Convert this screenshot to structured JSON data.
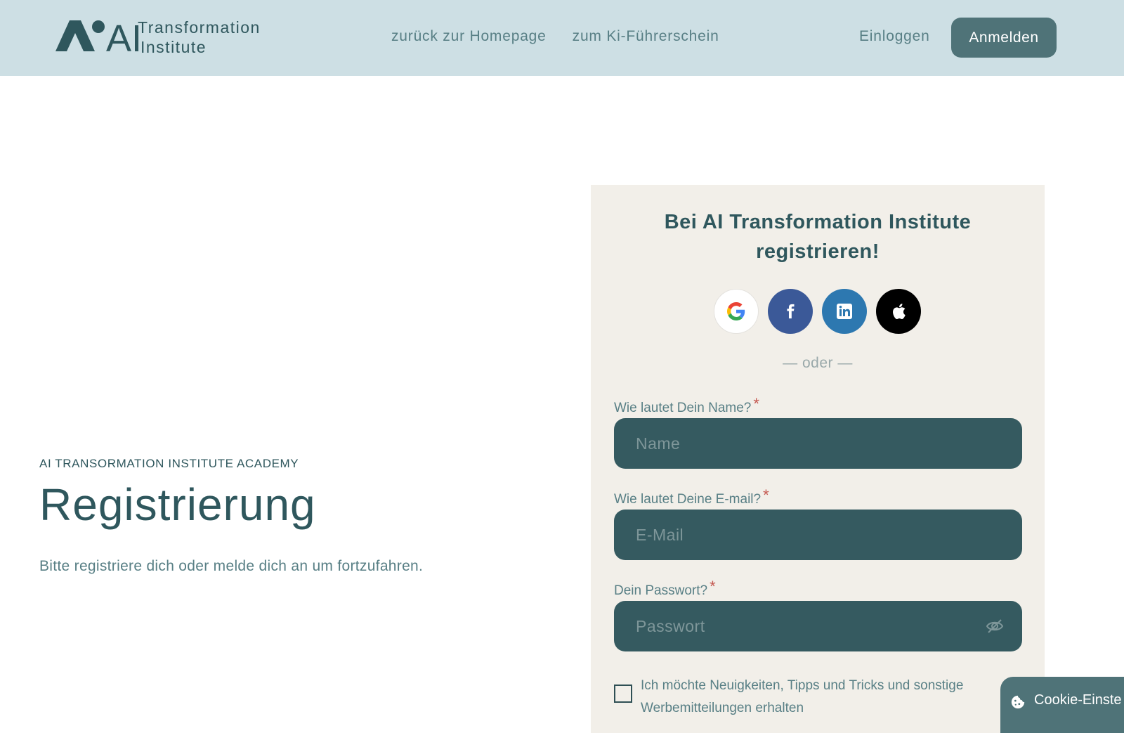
{
  "header": {
    "logo_mark_text": "AI",
    "logo_text_line1": "Transformation",
    "logo_text_line2": "Institute",
    "nav": [
      {
        "label": "zurück zur Homepage"
      },
      {
        "label": "zum Ki-Führerschein"
      }
    ],
    "login_label": "Einloggen",
    "signup_label": "Anmelden"
  },
  "hero": {
    "eyebrow": "AI TRANSORMATION INSTITUTE ACADEMY",
    "title": "Registrierung",
    "subtitle": "Bitte registriere dich oder melde dich an um fortzufahren."
  },
  "card": {
    "title": "Bei AI Transformation Institute registrieren!",
    "socials": [
      {
        "icon": "google-icon",
        "color": "#ffffff"
      },
      {
        "icon": "facebook-icon",
        "color": "#3b5998"
      },
      {
        "icon": "linkedin-icon",
        "color": "#2d78b0"
      },
      {
        "icon": "apple-icon",
        "color": "#000000"
      }
    ],
    "divider": "— oder —",
    "name_label": "Wie lautet Dein Name?",
    "name_placeholder": "Name",
    "email_label": "Wie lautet Deine E-mail?",
    "email_placeholder": "E-Mail",
    "password_label": "Dein Passwort?",
    "password_placeholder": "Passwort",
    "required_marker": "*",
    "newsletter_label": "Ich möchte Neuigkeiten, Tipps und Tricks und sonstige Werbemitteilungen erhalten",
    "newsletter_checked": false
  },
  "cookie": {
    "label": "Cookie-Einste",
    "icon": "cookie-icon"
  },
  "colors": {
    "header_bg": "#cddfe4",
    "primary": "#2f575d",
    "button_bg": "#4f7378",
    "field_bg": "#355a60",
    "card_bg": "#f2efe9",
    "required": "#c4574f"
  }
}
